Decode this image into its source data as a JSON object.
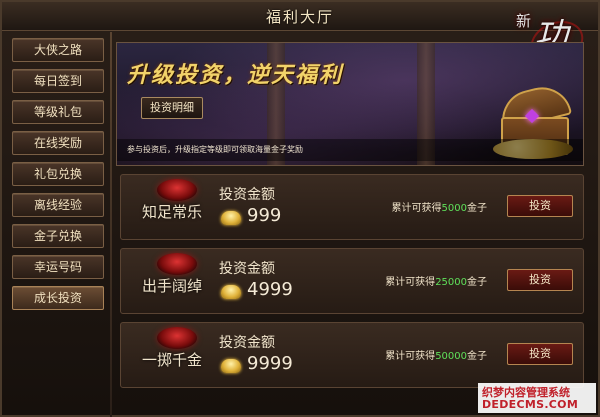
{
  "window": {
    "title": "福利大厅"
  },
  "logo": {
    "big": "新",
    "main": "功夫",
    "sub": ""
  },
  "sidebar": {
    "items": [
      {
        "label": "大侠之路"
      },
      {
        "label": "每日签到"
      },
      {
        "label": "等级礼包"
      },
      {
        "label": "在线奖励"
      },
      {
        "label": "礼包兑换"
      },
      {
        "label": "离线经验"
      },
      {
        "label": "金子兑换"
      },
      {
        "label": "幸运号码"
      },
      {
        "label": "成长投资"
      }
    ],
    "active_index": 8
  },
  "banner": {
    "title": "升级投资，逆天福利",
    "detail_button": "投资明细",
    "description": "参与投资后，升级指定等级即可领取海量金子奖励"
  },
  "investments": [
    {
      "name": "知足常乐",
      "amount_label": "投资金额",
      "amount": "999",
      "reward_prefix": "累计可获得",
      "reward": "5000",
      "reward_suffix": "金子",
      "button": "投资"
    },
    {
      "name": "出手阔绰",
      "amount_label": "投资金额",
      "amount": "4999",
      "reward_prefix": "累计可获得",
      "reward": "25000",
      "reward_suffix": "金子",
      "button": "投资"
    },
    {
      "name": "一掷千金",
      "amount_label": "投资金额",
      "amount": "9999",
      "reward_prefix": "累计可获得",
      "reward": "50000",
      "reward_suffix": "金子",
      "button": "投资"
    }
  ],
  "watermark": {
    "line1": "织梦内容管理系统",
    "line2": "DEDECMS.COM"
  },
  "colors": {
    "reward_number": "#5fe05a",
    "banner_title": "#f2d36a",
    "invest_button": "#6a1a14"
  }
}
